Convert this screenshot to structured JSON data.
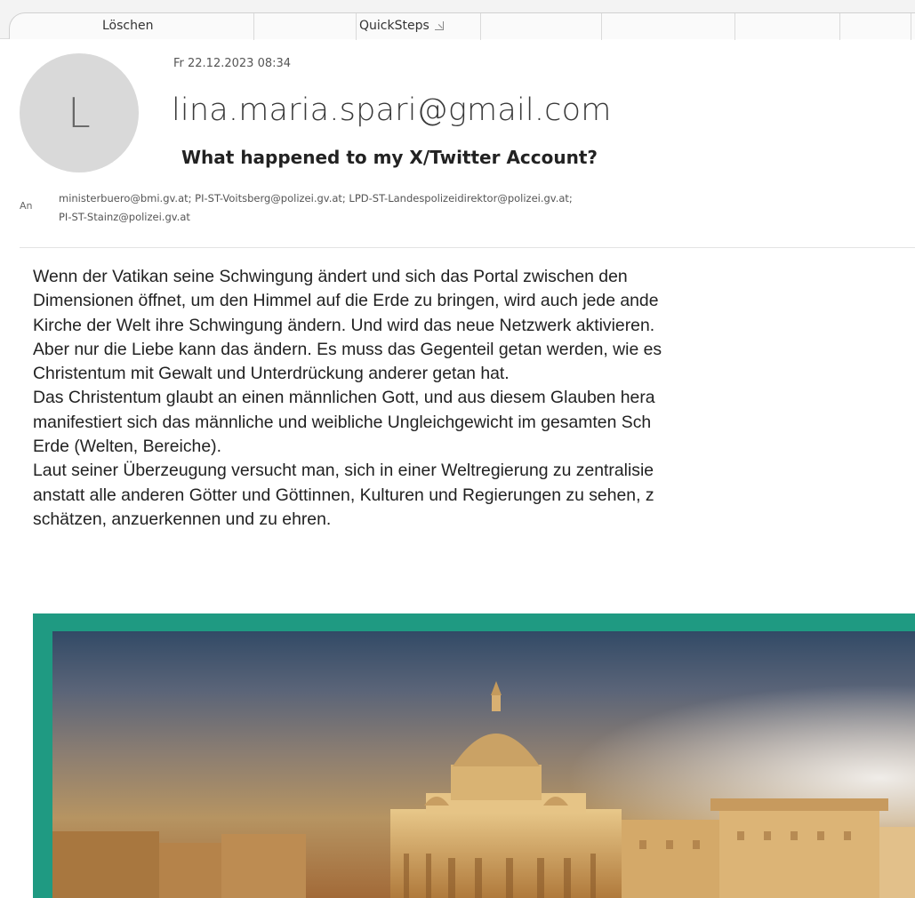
{
  "ribbon": {
    "groups": [
      {
        "label": "Löschen"
      },
      {
        "label": "QuickSteps"
      }
    ]
  },
  "email": {
    "avatar_initial": "L",
    "date": "Fr 22.12.2023 08:34",
    "sender": "lina.maria.spari@gmail.com",
    "subject": "What happened to my X/Twitter Account?",
    "to_label": "An",
    "recipients_line1": "ministerbuero@bmi.gv.at; PI-ST-Voitsberg@polizei.gv.at; LPD-ST-Landespolizeidirektor@polizei.gv.at;",
    "recipients_line2": "PI-ST-Stainz@polizei.gv.at",
    "body_lines": [
      "Wenn der Vatikan seine Schwingung ändert und sich das Portal zwischen den",
      "Dimensionen öffnet, um den Himmel auf die Erde zu bringen, wird auch jede ande",
      "Kirche der Welt ihre Schwingung ändern. Und wird das neue Netzwerk aktivieren.",
      "Aber nur die Liebe kann das ändern. Es muss das Gegenteil getan werden, wie es",
      "Christentum mit Gewalt und Unterdrückung anderer getan hat.",
      "Das Christentum glaubt an einen männlichen Gott, und aus diesem Glauben hera",
      "manifestiert sich das männliche und weibliche Ungleichgewicht im gesamten Sch",
      "Erde (Welten, Bereiche).",
      "Laut seiner Überzeugung versucht man, sich in einer Weltregierung zu zentralisie",
      "anstatt alle anderen Götter und Göttinnen, Kulturen und Regierungen zu sehen, z",
      "schätzen, anzuerkennen und zu ehren."
    ]
  },
  "colors": {
    "image_frame": "#1f9a82",
    "avatar_bg": "#d9d9d9"
  },
  "icons": [
    "dialog-launcher-icon"
  ]
}
